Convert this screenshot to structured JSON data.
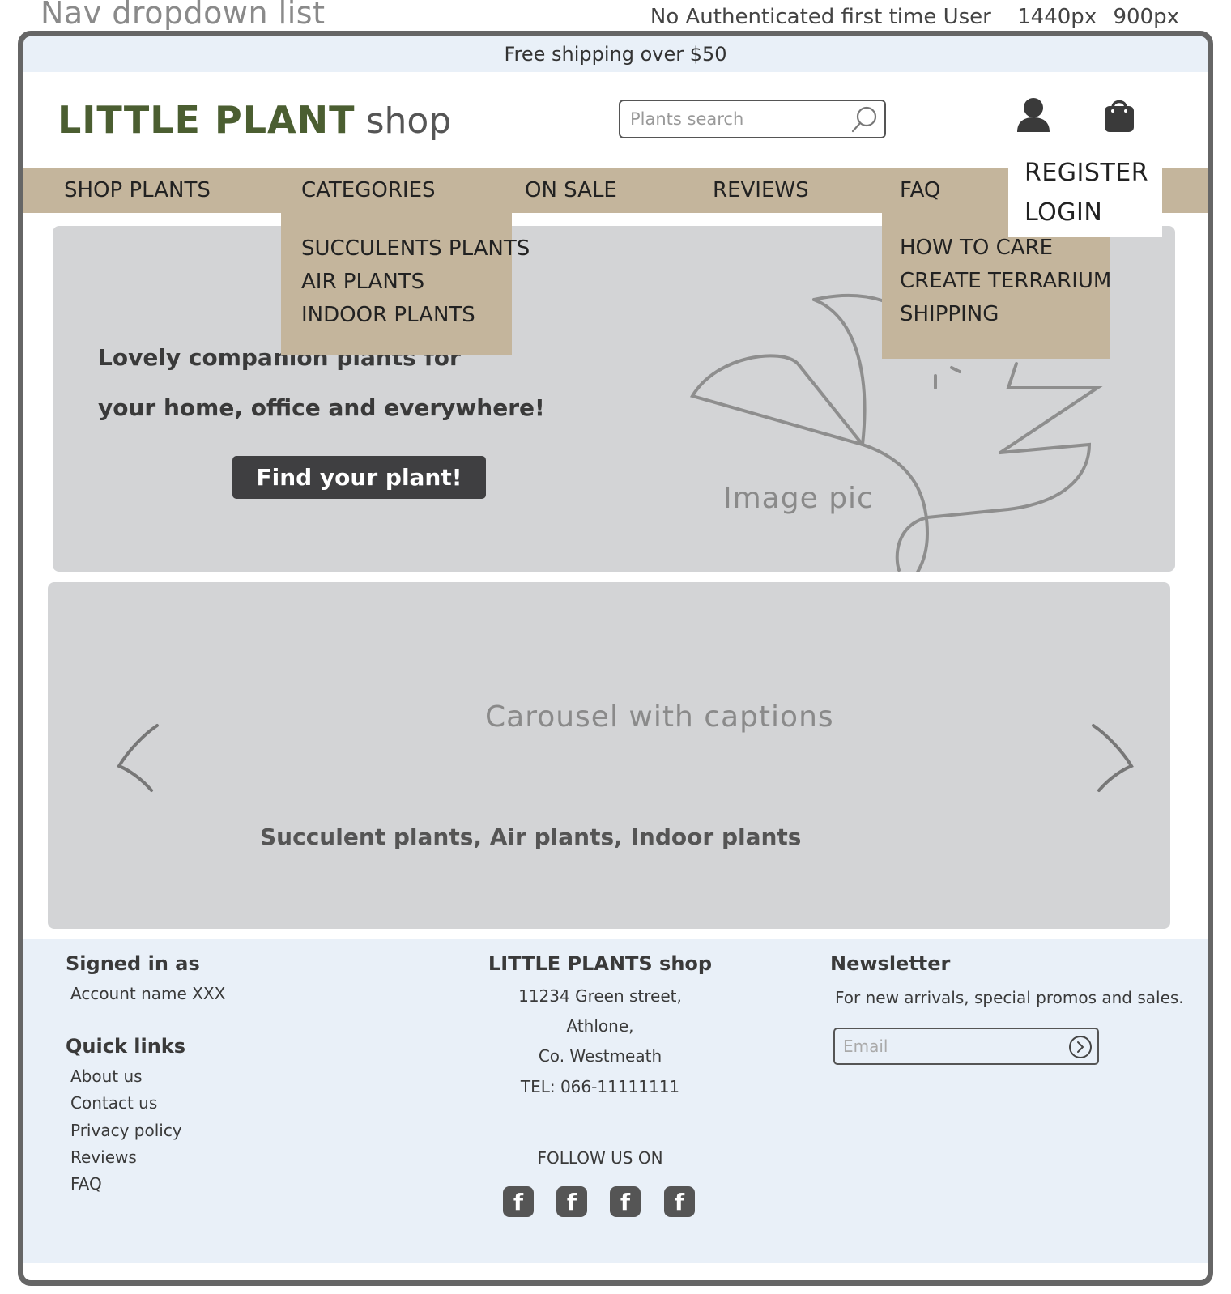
{
  "annotation": {
    "title": "Nav dropdown list",
    "user_state": "No Authenticated first time User",
    "width_label": "1440px",
    "height_label": "900px"
  },
  "promo": {
    "text": "Free shipping over $50"
  },
  "logo": {
    "main": "LITTLE PLANT",
    "sub": "shop"
  },
  "search": {
    "placeholder": "Plants search",
    "icon": "search-icon"
  },
  "header_icons": {
    "user": "user-icon",
    "cart": "shopping-bag-icon"
  },
  "account_menu": {
    "items": [
      {
        "label": "REGISTER"
      },
      {
        "label": "LOGIN"
      }
    ]
  },
  "nav": {
    "items": [
      {
        "label": "SHOP PLANTS"
      },
      {
        "label": "CATEGORIES"
      },
      {
        "label": "ON SALE"
      },
      {
        "label": "REVIEWS"
      },
      {
        "label": "FAQ"
      }
    ],
    "categories_dropdown": [
      {
        "label": "SUCCULENTS PLANTS"
      },
      {
        "label": "AIR PLANTS"
      },
      {
        "label": "INDOOR PLANTS"
      }
    ],
    "faq_dropdown": [
      {
        "label": "HOW TO CARE"
      },
      {
        "label": "CREATE TERRARIUM"
      },
      {
        "label": "SHIPPING"
      }
    ]
  },
  "hero": {
    "line1": "Lovely companion plants for",
    "line2": "your home, office and everywhere!",
    "button": "Find your plant!",
    "image_label": "Image pic"
  },
  "carousel": {
    "title": "Carousel with captions",
    "caption": "Succulent plants,  Air plants,  Indoor plants"
  },
  "footer": {
    "signed_in_heading": "Signed in as",
    "account_name": "Account name XXX",
    "quick_links_heading": "Quick links",
    "quick_links": [
      {
        "label": "About us"
      },
      {
        "label": "Contact us"
      },
      {
        "label": "Privacy policy"
      },
      {
        "label": "Reviews"
      },
      {
        "label": "FAQ"
      }
    ],
    "shop_name": "LITTLE PLANTS shop",
    "address": [
      "11234 Green street,",
      "Athlone,",
      "Co. Westmeath",
      "TEL: 066-11111111"
    ],
    "follow_label": "FOLLOW US ON",
    "social": [
      {
        "label": "f"
      },
      {
        "label": "f"
      },
      {
        "label": "f"
      },
      {
        "label": "f"
      }
    ],
    "newsletter_heading": "Newsletter",
    "newsletter_text": "For new arrivals, special promos and sales.",
    "email_placeholder": "Email"
  },
  "colors": {
    "promo_bg": "#e9f0f8",
    "nav_bg": "#c4b59c",
    "logo_green": "#4b5e31",
    "placeholder_gray": "#d3d4d6",
    "button_dark": "#3f3f41",
    "footer_bg": "#e9f0f8"
  }
}
